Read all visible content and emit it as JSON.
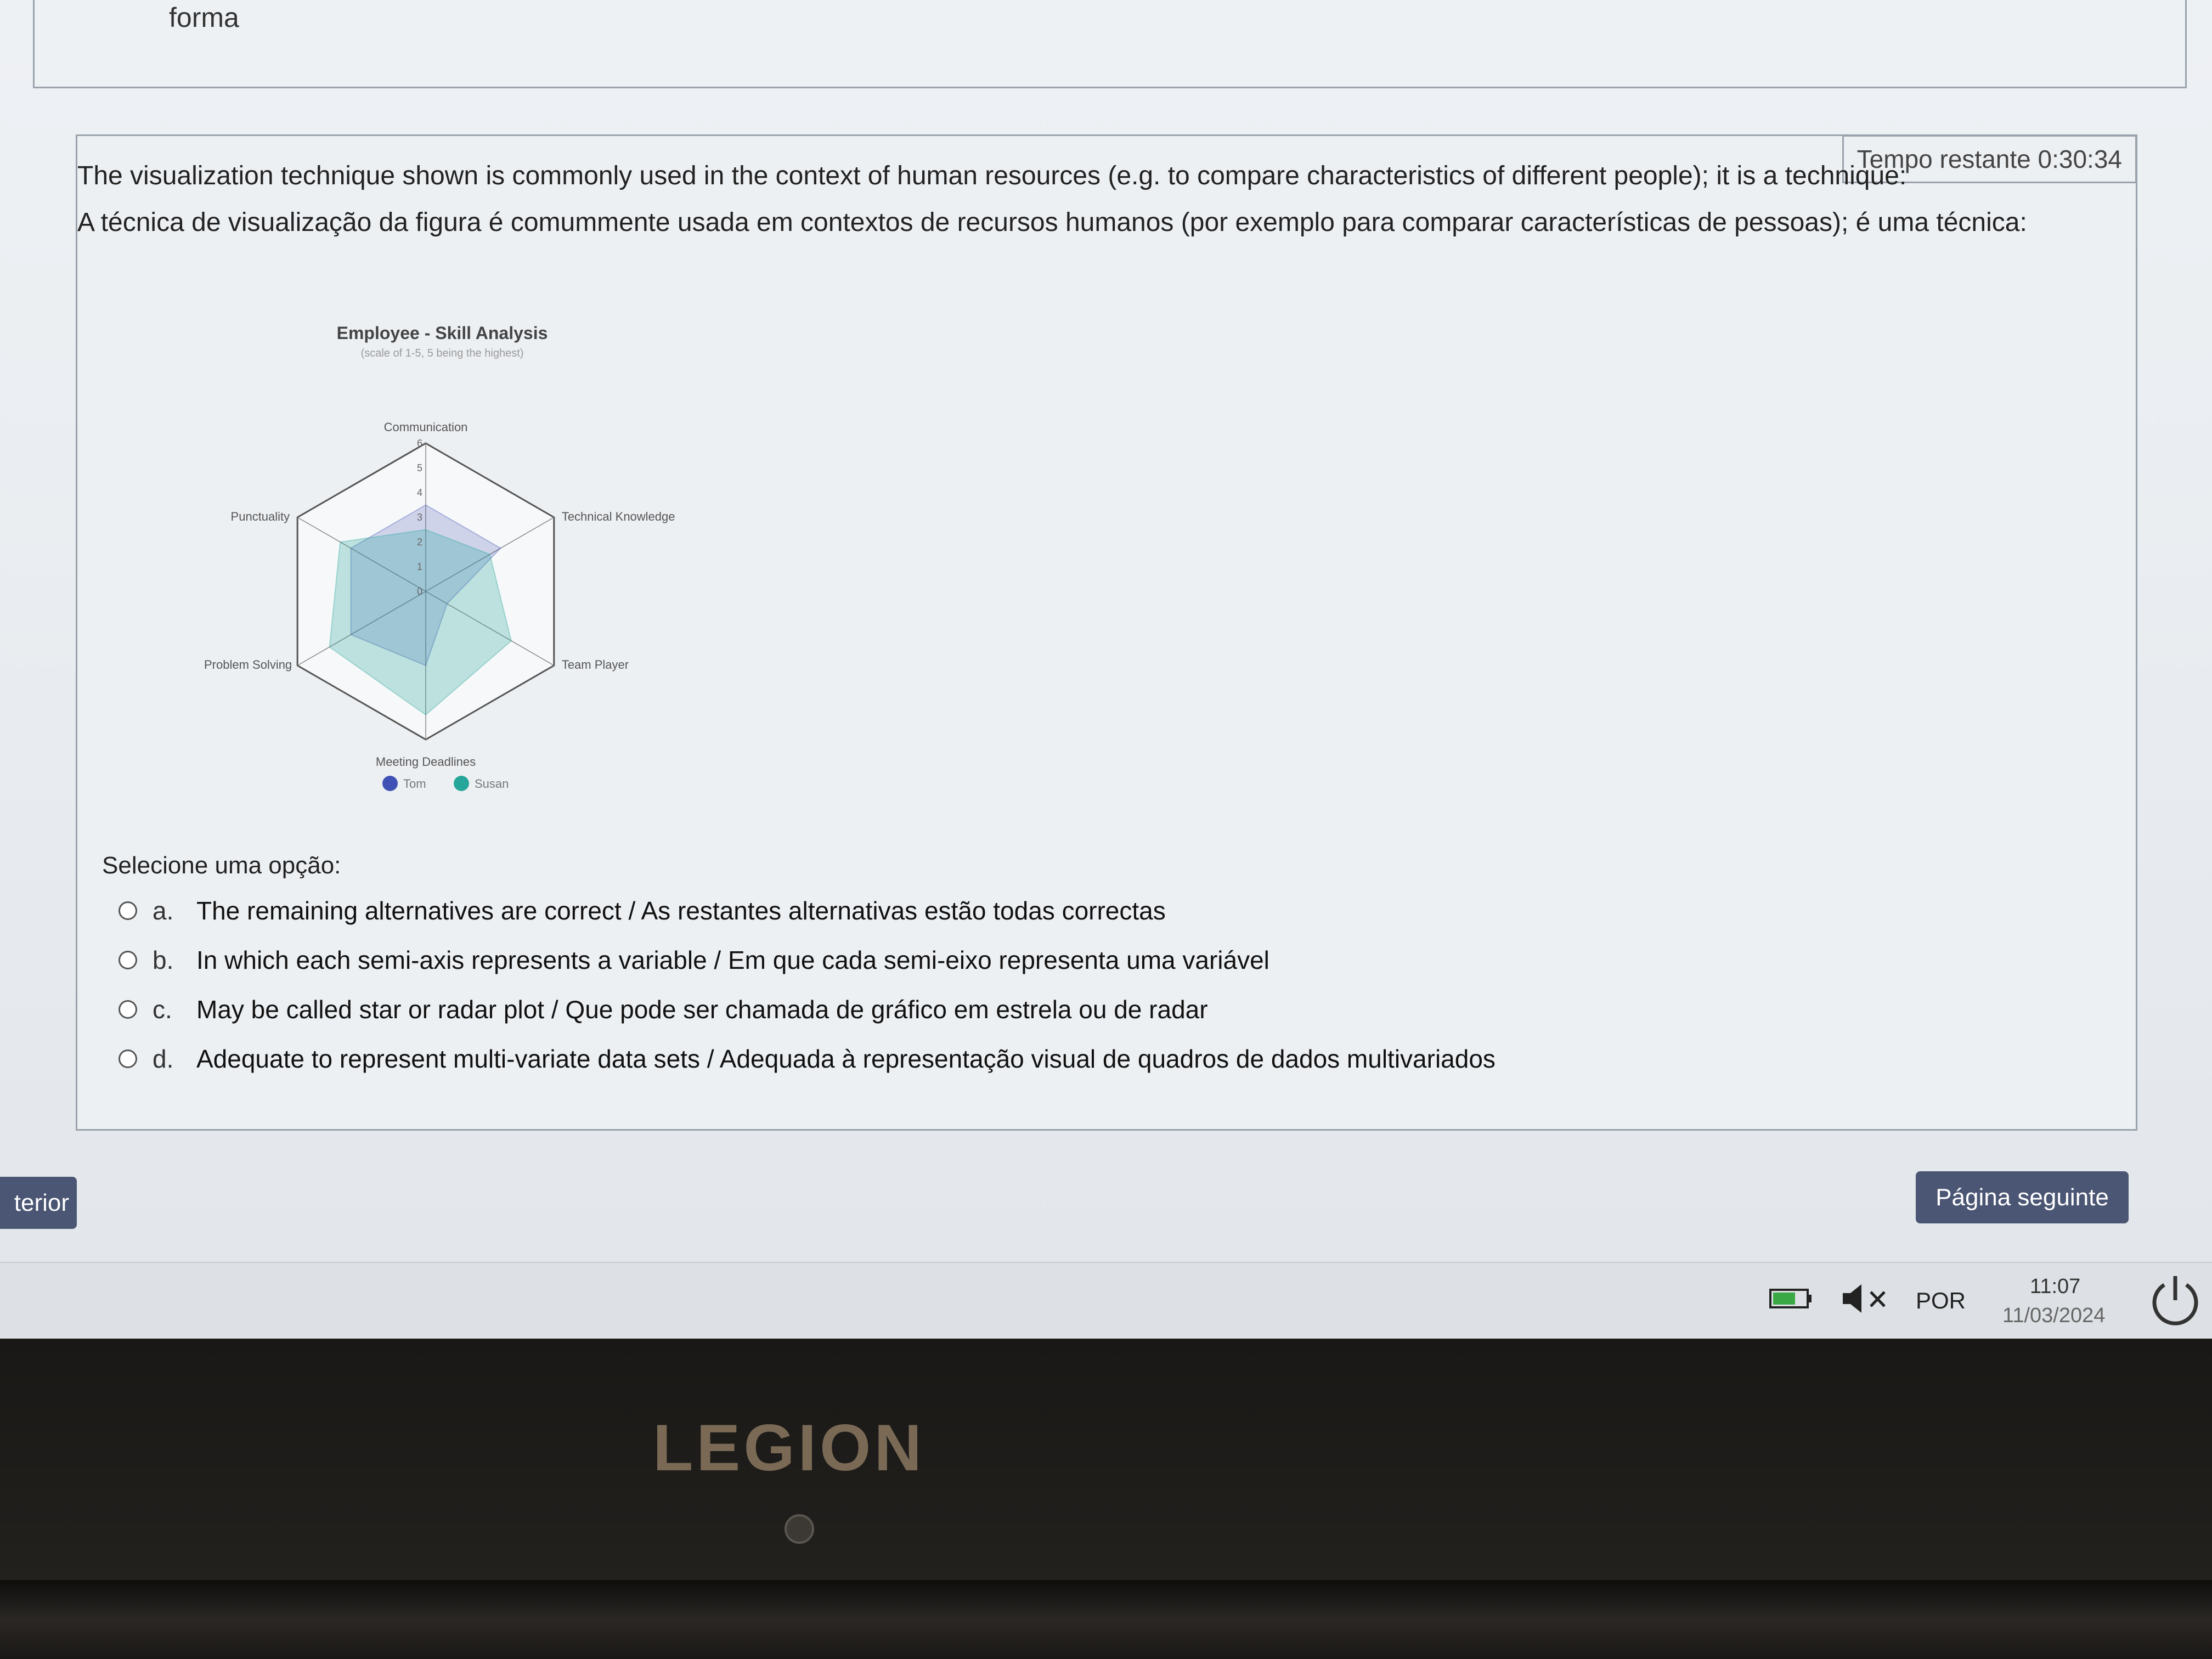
{
  "prev_question": {
    "text": "forma"
  },
  "timer": {
    "label": "Tempo restante 0:30:34"
  },
  "question": {
    "text_en": "The visualization technique shown is commonly used in the context of human resources (e.g. to compare characteristics of different people); it is a technique:",
    "text_pt": "A técnica de visualização da figura é comummente usada em contextos de recursos humanos (por exemplo para comparar características de pessoas); é uma técnica:"
  },
  "chart_data": {
    "type": "radar",
    "title": "Employee - Skill Analysis",
    "subtitle": "(scale of 1-5, 5 being the highest)",
    "axes": [
      "Communication",
      "Technical Knowledge",
      "Team Player",
      "Meeting Deadlines",
      "Problem Solving",
      "Punctuality"
    ],
    "scale_ticks": [
      "0",
      "1",
      "2",
      "3",
      "4",
      "5",
      "6"
    ],
    "range": [
      0,
      6
    ],
    "series": [
      {
        "name": "Tom",
        "color": "#3f51b5",
        "values": [
          3.5,
          3.5,
          1,
          3,
          3.5,
          3.5
        ]
      },
      {
        "name": "Susan",
        "color": "#26a69a",
        "values": [
          2.5,
          3,
          4,
          5,
          4.5,
          4
        ]
      }
    ]
  },
  "options": {
    "label": "Selecione uma opção:",
    "items": [
      {
        "letter": "a.",
        "text": "The remaining alternatives are correct / As restantes alternativas estão todas correctas"
      },
      {
        "letter": "b.",
        "text": "In which each semi-axis represents a variable / Em que cada semi-eixo representa uma variável"
      },
      {
        "letter": "c.",
        "text": "May be called star or radar plot / Que pode ser chamada de gráfico em estrela ou de radar"
      },
      {
        "letter": "d.",
        "text": "Adequate to represent multi-variate data sets / Adequada à representação visual de quadros de dados multivariados"
      }
    ]
  },
  "nav": {
    "prev_label": "terior",
    "next_label": "Página seguinte"
  },
  "taskbar": {
    "lang": "POR",
    "time": "11:07",
    "date": "11/03/2024"
  },
  "bezel": {
    "logo": "LEGION"
  }
}
